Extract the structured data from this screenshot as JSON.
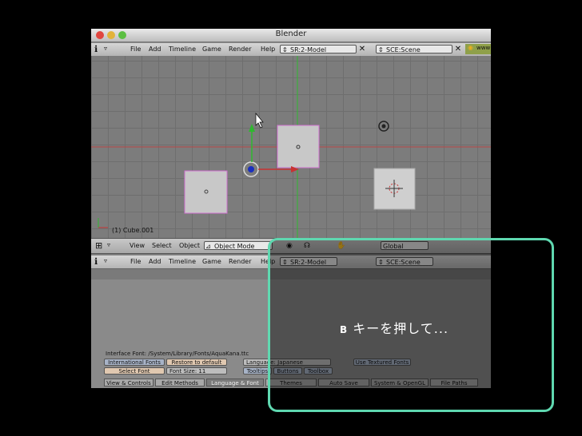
{
  "window": {
    "title": "Blender",
    "menu": [
      "File",
      "Add",
      "Timeline",
      "Game",
      "Render",
      "Help"
    ],
    "screen": "SR:2-Model",
    "scene": "SCE:Scene",
    "www": "www"
  },
  "viewport": {
    "object_label": "(1) Cube.001",
    "header": {
      "menu": [
        "View",
        "Select",
        "Object"
      ],
      "mode": "Object Mode",
      "orientation": "Global"
    }
  },
  "prefs_header": {
    "menu": [
      "File",
      "Add",
      "Timeline",
      "Game",
      "Render",
      "Help"
    ],
    "screen": "SR:2-Model",
    "scene": "SCE:Scene"
  },
  "prefs": {
    "interface_font": "Interface Font: /System/Library/Fonts/AquaKana.ttc",
    "intl_fonts": "International Fonts",
    "restore_default": "Restore to default",
    "select_font": "Select Font",
    "font_size": "Font Size:  11",
    "language": "Language: Japanese",
    "tooltips": "Tooltips",
    "buttons": "Buttons",
    "toolbox": "Toolbox",
    "use_textured_fonts": "Use Textured Fonts",
    "tabs": [
      "View & Controls",
      "Edit Methods",
      "Language & Font",
      "Themes",
      "Auto Save",
      "System & OpenGL",
      "File Paths"
    ]
  },
  "caption": {
    "key": "B",
    "text": "キーを押して..."
  },
  "colors": {
    "overlay_border": "#5fd8b0",
    "selected_edge": "#d070d0",
    "x_axis": "#c83232",
    "y_axis": "#2fb82f"
  }
}
